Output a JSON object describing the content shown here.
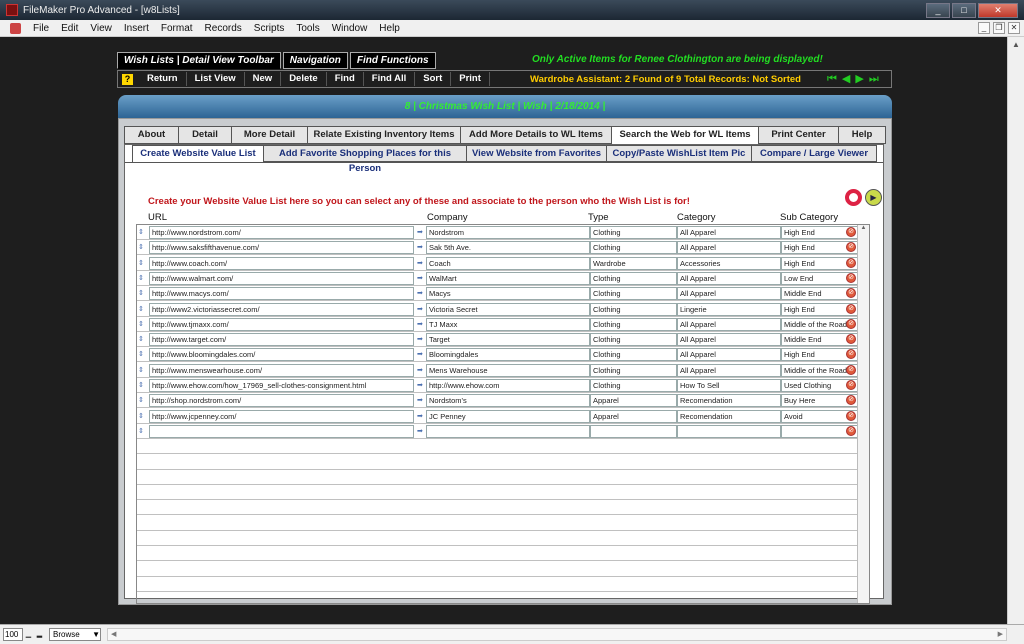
{
  "window": {
    "title": "FileMaker Pro Advanced - [w8Lists]",
    "controls": [
      "_",
      "□",
      "✕"
    ]
  },
  "menu": [
    "File",
    "Edit",
    "View",
    "Insert",
    "Format",
    "Records",
    "Scripts",
    "Tools",
    "Window",
    "Help"
  ],
  "mdi_controls": [
    "_",
    "❐",
    "✕"
  ],
  "toolbar": {
    "tabs": [
      "Wish Lists | Detail View Toolbar",
      "Navigation",
      "Find Functions"
    ],
    "help": "?",
    "buttons": [
      "Return",
      "List View",
      "New",
      "Delete",
      "Find",
      "Find All",
      "Sort",
      "Print"
    ]
  },
  "active_message": "Only Active Items for Renee Clothington are being displayed!",
  "assistant_status": "Wardrobe Assistant:  2 Found of 9 Total Records: Not Sorted",
  "record_header": "8  |  Christmas Wish List  |  Wish  |  2/18/2014  |",
  "tabs_main": [
    "About",
    "Detail",
    "More Detail",
    "Relate Existing Inventory Items",
    "Add More Details to WL Items",
    "Search the Web for WL Items",
    "Print Center",
    "Help"
  ],
  "tabs_sub": [
    "Create Website Value List",
    "Add Favorite Shopping Places for this Person",
    "View Website from Favorites",
    "Copy/Paste WishList Item Pic",
    "Compare / Large Viewer"
  ],
  "instruction": "Create your Website Value List here so you can select any of these  and associate to the person who the Wish List is for!",
  "columns": {
    "url": "URL",
    "company": "Company",
    "type": "Type",
    "category": "Category",
    "subcategory": "Sub Category"
  },
  "rows": [
    {
      "url": "http://www.nordstrom.com/",
      "company": "Nordstrom",
      "type": "Clothing",
      "category": "All Apparel",
      "subcategory": "High End"
    },
    {
      "url": "http://www.saksfifthavenue.com/",
      "company": "Sak 5th Ave.",
      "type": "Clothing",
      "category": "All Apparel",
      "subcategory": "High End"
    },
    {
      "url": "http://www.coach.com/",
      "company": "Coach",
      "type": "Wardrobe",
      "category": "Accessories",
      "subcategory": "High End"
    },
    {
      "url": "http://www.walmart.com/",
      "company": "WalMart",
      "type": "Clothing",
      "category": "All Apparel",
      "subcategory": "Low End"
    },
    {
      "url": "http://www.macys.com/",
      "company": "Macys",
      "type": "Clothing",
      "category": "All Apparel",
      "subcategory": "Middle End"
    },
    {
      "url": "http://www2.victoriassecret.com/",
      "company": "Victoria Secret",
      "type": "Clothing",
      "category": "Lingerie",
      "subcategory": "High End"
    },
    {
      "url": "http://www.tjmaxx.com/",
      "company": "TJ Maxx",
      "type": "Clothing",
      "category": "All Apparel",
      "subcategory": "Middle of the Road"
    },
    {
      "url": "http://www.target.com/",
      "company": "Target",
      "type": "Clothing",
      "category": "All Apparel",
      "subcategory": "Middle End"
    },
    {
      "url": "http://www.bloomingdales.com/",
      "company": "Bloomingdales",
      "type": "Clothing",
      "category": "All Apparel",
      "subcategory": "High End"
    },
    {
      "url": "http://www.menswearhouse.com/",
      "company": "Mens Warehouse",
      "type": "Clothing",
      "category": "All Apparel",
      "subcategory": "Middle of the Road"
    },
    {
      "url": "http://www.ehow.com/how_17969_sell-clothes-consignment.html",
      "company": "http://www.ehow.com",
      "type": "Clothing",
      "category": "How To Sell",
      "subcategory": "Used Clothing"
    },
    {
      "url": "http://shop.nordstrom.com/",
      "company": "Nordstom's",
      "type": "Apparel",
      "category": "Recomendation",
      "subcategory": "Buy Here"
    },
    {
      "url": "http://www.jcpenney.com/",
      "company": "JC Penney",
      "type": "Apparel",
      "category": "Recomendation",
      "subcategory": "Avoid"
    },
    {
      "url": "",
      "company": "",
      "type": "",
      "category": "",
      "subcategory": ""
    }
  ],
  "statusbar": {
    "zoom": "100",
    "mode": "Browse"
  }
}
